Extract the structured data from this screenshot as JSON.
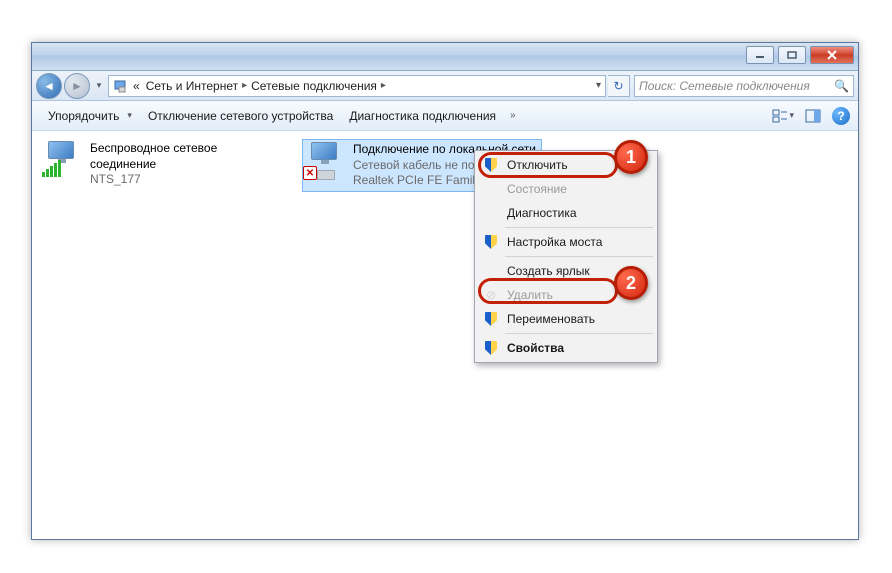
{
  "breadcrumb": {
    "root_glyph": "«",
    "level1": "Сеть и Интернет",
    "level2": "Сетевые подключения"
  },
  "search": {
    "placeholder": "Поиск: Сетевые подключения"
  },
  "toolbar": {
    "organize": "Упорядочить",
    "disable_device": "Отключение сетевого устройства",
    "diagnose": "Диагностика подключения"
  },
  "connections": [
    {
      "name": "Беспроводное сетевое соединение",
      "network": "NTS_177",
      "device": ""
    },
    {
      "name": "Подключение по локальной сети",
      "status": "Сетевой кабель не подключен",
      "device": "Realtek PCIe FE Family"
    }
  ],
  "context_menu": {
    "items": [
      {
        "label": "Отключить",
        "icon": "shield",
        "disabled": false
      },
      {
        "label": "Состояние",
        "icon": "",
        "disabled": true
      },
      {
        "label": "Диагностика",
        "icon": "",
        "disabled": false
      },
      {
        "sep": true
      },
      {
        "label": "Настройка моста",
        "icon": "shield",
        "disabled": false
      },
      {
        "sep": true
      },
      {
        "label": "Создать ярлык",
        "icon": "",
        "disabled": false
      },
      {
        "label": "Удалить",
        "icon": "faint",
        "disabled": true
      },
      {
        "label": "Переименовать",
        "icon": "shield",
        "disabled": false
      },
      {
        "sep": true
      },
      {
        "label": "Свойства",
        "icon": "shield",
        "disabled": false,
        "bold": true
      }
    ]
  },
  "annotations": {
    "b1": "1",
    "b2": "2"
  }
}
